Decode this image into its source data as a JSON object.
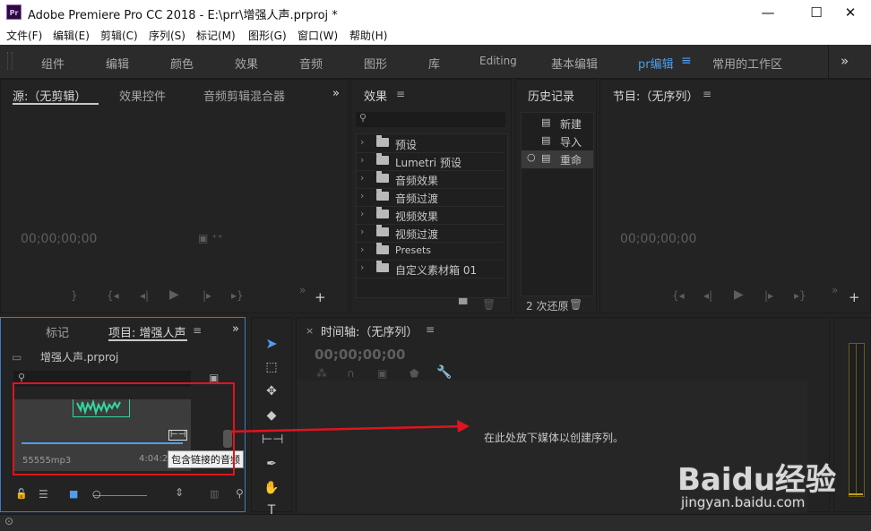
{
  "window": {
    "title": "Adobe Premiere Pro CC 2018 - E:\\prr\\增强人声.prproj *",
    "app_icon": "Pr",
    "minimize": "—",
    "maximize": "☐",
    "close": "✕"
  },
  "menu": [
    "文件(F)",
    "编辑(E)",
    "剪辑(C)",
    "序列(S)",
    "标记(M)",
    "图形(G)",
    "窗口(W)",
    "帮助(H)"
  ],
  "workspaces": {
    "items": [
      "组件",
      "编辑",
      "颜色",
      "效果",
      "音频",
      "图形",
      "库",
      "Editing",
      "基本编辑",
      "pr编辑",
      "常用的工作区"
    ],
    "active": "pr编辑",
    "overflow": "»"
  },
  "source_panel": {
    "tabs": [
      "源:（无剪辑）",
      "效果控件",
      "音频剪辑混合器"
    ],
    "timecode": "00;00;00;00"
  },
  "effects_panel": {
    "title": "效果",
    "search_placeholder": "",
    "items": [
      "预设",
      "Lumetri 预设",
      "音频效果",
      "音频过渡",
      "视频效果",
      "视频过渡",
      "Presets",
      "自定义素材箱 01"
    ]
  },
  "history_panel": {
    "title": "历史记录",
    "items": [
      "新建",
      "导入",
      "重命"
    ],
    "footer": "2 次还原"
  },
  "program_panel": {
    "title": "节目:（无序列）",
    "timecode": "00;00;00;00"
  },
  "project_panel": {
    "tabs": [
      "标记",
      "项目: 增强人声"
    ],
    "file": "增强人声.prproj",
    "clip_name": "55555mp3",
    "clip_duration": "4:04:21",
    "tooltip": "包含链接的音频"
  },
  "timeline_panel": {
    "title": "时间轴:（无序列）",
    "timecode": "00;00;00;00",
    "drop_hint": "在此处放下媒体以创建序列。"
  },
  "watermark": {
    "brand": "Baidu经验",
    "url": "jingyan.baidu.com"
  },
  "colors": {
    "accent": "#4f9ded",
    "panel_bg": "#232323",
    "annotation_red": "#e0141e",
    "waveform": "#33d6a0"
  }
}
